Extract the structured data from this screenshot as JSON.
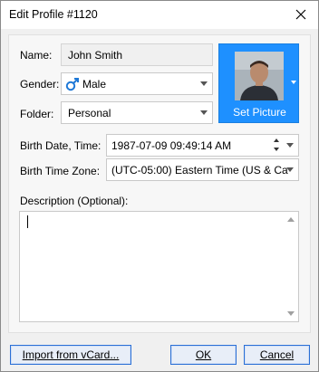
{
  "window": {
    "title": "Edit Profile #1120"
  },
  "form": {
    "name_label": "Name:",
    "name_value": "John Smith",
    "gender_label": "Gender:",
    "gender_value": "Male",
    "folder_label": "Folder:",
    "folder_value": "Personal",
    "birth_label": "Birth Date, Time:",
    "birth_value": "1987-07-09 09:49:14 AM",
    "timezone_label": "Birth Time Zone:",
    "timezone_value": "(UTC-05:00) Eastern Time (US & Ca",
    "description_label": "Description (Optional):",
    "description_value": ""
  },
  "picture": {
    "button_label": "Set Picture"
  },
  "buttons": {
    "import_label": "Import from vCard...",
    "ok_label": "OK",
    "cancel_label": "Cancel"
  },
  "colors": {
    "accent": "#1E90FF",
    "male_symbol": "#1E78D7",
    "button_border": "#2A6FD6"
  },
  "icons": [
    "close-icon",
    "male-symbol-icon",
    "chevron-down-icon",
    "spinner-icon",
    "profile-photo"
  ]
}
